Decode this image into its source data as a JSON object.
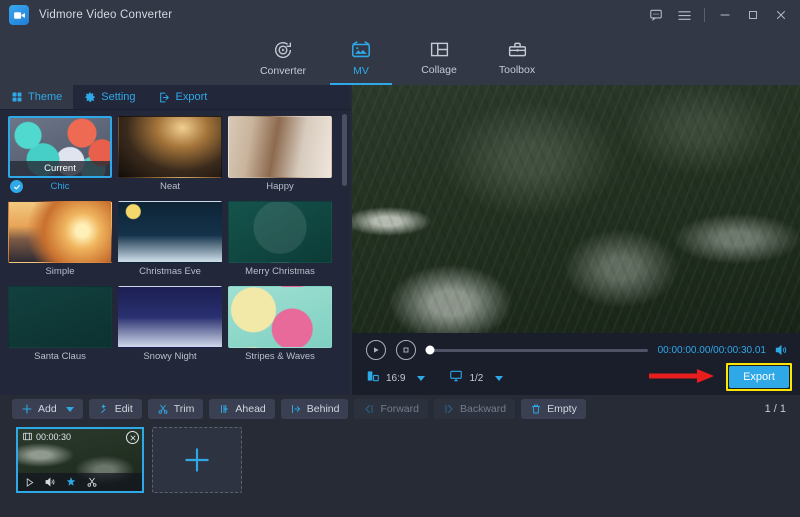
{
  "window": {
    "title": "Vidmore Video Converter",
    "logo_icon": "video-camera-icon",
    "controls": [
      {
        "name": "feedback-icon",
        "glyph": "chat"
      },
      {
        "name": "menu-icon",
        "glyph": "hamburger"
      },
      {
        "name": "minimize-icon",
        "glyph": "minimize"
      },
      {
        "name": "maximize-icon",
        "glyph": "maximize"
      },
      {
        "name": "close-icon",
        "glyph": "close"
      }
    ]
  },
  "topnav": {
    "active": "MV",
    "tabs": [
      {
        "label": "Converter",
        "icon": "convert-icon"
      },
      {
        "label": "MV",
        "icon": "mv-tv-icon"
      },
      {
        "label": "Collage",
        "icon": "collage-icon"
      },
      {
        "label": "Toolbox",
        "icon": "toolbox-icon"
      }
    ]
  },
  "panel": {
    "tabs": [
      {
        "label": "Theme",
        "icon": "grid-icon",
        "active": true
      },
      {
        "label": "Setting",
        "icon": "gear-icon",
        "active": false
      },
      {
        "label": "Export",
        "icon": "export-icon",
        "active": false
      }
    ],
    "themes": [
      {
        "name": "Chic",
        "art": "art-chic",
        "selected": true,
        "badge": "Current"
      },
      {
        "name": "Neat",
        "art": "art-neat",
        "selected": false,
        "badge": ""
      },
      {
        "name": "Happy",
        "art": "art-happy",
        "selected": false,
        "badge": ""
      },
      {
        "name": "Simple",
        "art": "art-simple",
        "selected": false,
        "badge": ""
      },
      {
        "name": "Christmas Eve",
        "art": "art-xmaseve",
        "selected": false,
        "badge": ""
      },
      {
        "name": "Merry Christmas",
        "art": "art-merry",
        "selected": false,
        "badge": ""
      },
      {
        "name": "Santa Claus",
        "art": "art-santa",
        "selected": false,
        "badge": ""
      },
      {
        "name": "Snowy Night",
        "art": "art-snowy",
        "selected": false,
        "badge": ""
      },
      {
        "name": "Stripes & Waves",
        "art": "art-stripes",
        "selected": false,
        "badge": ""
      }
    ]
  },
  "player": {
    "play_icon": "play-icon",
    "stop_icon": "stop-icon",
    "progress_percent": 0,
    "current_time": "00:00:00.00",
    "total_time": "00:00:30.01",
    "timecode": "00:00:00.00/00:00:30.01",
    "volume_icon": "volume-icon",
    "aspect_ratio": "16:9",
    "aspect_icon": "aspect-ratio-icon",
    "quality": "1/2",
    "quality_icon": "monitor-icon",
    "export_label": "Export",
    "highlight_color": "#ffe600",
    "accent_color": "#2fa8e8",
    "arrow_color": "#e81e1e"
  },
  "toolbar": {
    "buttons": [
      {
        "label": "Add",
        "icon": "plus-icon",
        "disabled": false,
        "has_caret": true
      },
      {
        "label": "Edit",
        "icon": "magic-wand-icon",
        "disabled": false,
        "has_caret": false
      },
      {
        "label": "Trim",
        "icon": "scissors-icon",
        "disabled": false,
        "has_caret": false
      },
      {
        "label": "Ahead",
        "icon": "insert-ahead-icon",
        "disabled": false,
        "has_caret": false
      },
      {
        "label": "Behind",
        "icon": "insert-behind-icon",
        "disabled": false,
        "has_caret": false
      },
      {
        "label": "Forward",
        "icon": "move-forward-icon",
        "disabled": true,
        "has_caret": false
      },
      {
        "label": "Backward",
        "icon": "move-backward-icon",
        "disabled": true,
        "has_caret": false
      },
      {
        "label": "Empty",
        "icon": "trash-icon",
        "disabled": false,
        "has_caret": false
      }
    ],
    "page_count": "1 / 1"
  },
  "storyboard": {
    "clip": {
      "duration": "00:00:30",
      "film_icon": "film-icon",
      "close_icon": "close-icon",
      "actions": [
        {
          "name": "play-icon"
        },
        {
          "name": "volume-icon"
        },
        {
          "name": "effects-icon"
        },
        {
          "name": "scissors-icon"
        }
      ]
    },
    "add_label": "+",
    "add_icon": "plus-icon"
  }
}
